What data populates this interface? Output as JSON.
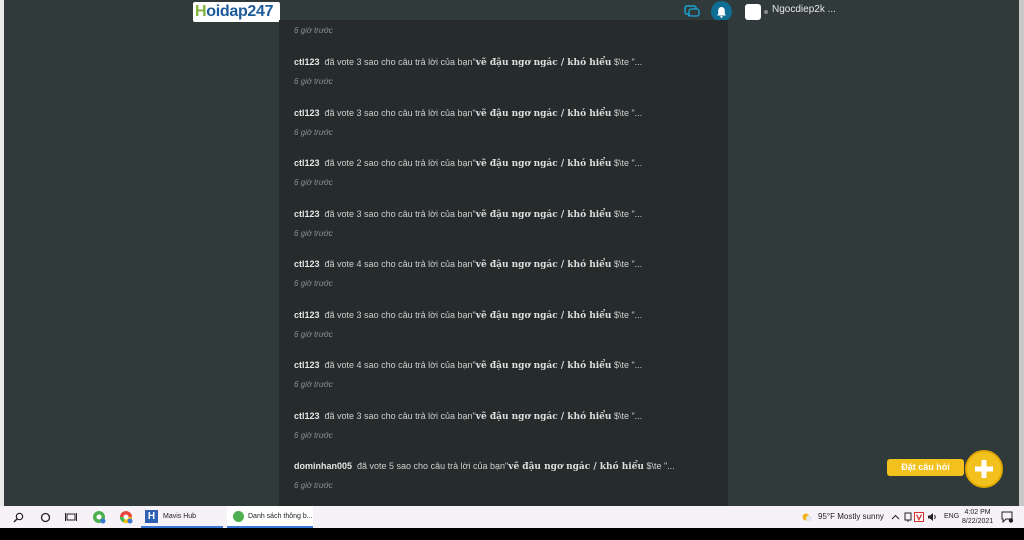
{
  "header": {
    "logo_h": "H",
    "logo_rest": "oidap247",
    "username": "Ngocdiep2k ..."
  },
  "feed": {
    "first_time": "6 giờ trước",
    "notifications": [
      {
        "user": "ctl123",
        "action": "đã vote 3 sao cho câu trả lời của bạn\"",
        "question": "vẽ đậu ngơ ngác / khó hiểu",
        "suffix": " $\\te \"...",
        "time": "6 giờ trước"
      },
      {
        "user": "ctl123",
        "action": "đã vote 3 sao cho câu trả lời của bạn\"",
        "question": "vẽ đậu ngơ ngác / khó hiểu",
        "suffix": " $\\te \"...",
        "time": "6 giờ trước"
      },
      {
        "user": "ctl123",
        "action": "đã vote 2 sao cho câu trả lời của bạn\"",
        "question": "vẽ đậu ngơ ngác / khó hiểu",
        "suffix": " $\\te \"...",
        "time": "6 giờ trước"
      },
      {
        "user": "ctl123",
        "action": "đã vote 3 sao cho câu trả lời của bạn\"",
        "question": "vẽ đậu ngơ ngác / khó hiểu",
        "suffix": " $\\te \"...",
        "time": "6 giờ trước"
      },
      {
        "user": "ctl123",
        "action": "đã vote 4 sao cho câu trả lời của bạn\"",
        "question": "vẽ đậu ngơ ngác / khó hiểu",
        "suffix": " $\\te \"...",
        "time": "6 giờ trước"
      },
      {
        "user": "ctl123",
        "action": "đã vote 3 sao cho câu trả lời của bạn\"",
        "question": "vẽ đậu ngơ ngác / khó hiểu",
        "suffix": " $\\te \"...",
        "time": "6 giờ trước"
      },
      {
        "user": "ctl123",
        "action": "đã vote 4 sao cho câu trả lời của bạn\"",
        "question": "vẽ đậu ngơ ngác / khó hiểu",
        "suffix": " $\\te \"...",
        "time": "6 giờ trước"
      },
      {
        "user": "ctl123",
        "action": "đã vote 3 sao cho câu trả lời của bạn\"",
        "question": "vẽ đậu ngơ ngác / khó hiểu",
        "suffix": " $\\te \"...",
        "time": "6 giờ trước"
      },
      {
        "user": "dominhan005",
        "action": "đã vote 5 sao cho câu trả lời của bạn\"",
        "question": "vẽ đậu ngơ ngác / khó hiểu",
        "suffix": " $\\te \"...",
        "time": "6 giờ trước"
      }
    ]
  },
  "ask_button": {
    "label": "Đặt câu hỏi"
  },
  "taskbar": {
    "apps": [
      {
        "label": "Mavis Hub"
      },
      {
        "label": "Danh sách thông b..."
      }
    ],
    "weather": "95°F  Mostly sunny",
    "language": "ENG",
    "time": "4:02 PM",
    "date": "8/22/2021"
  },
  "colors": {
    "accent": "#f3c11d",
    "page_bg": "#303a3b",
    "feed_bg": "#262b2c",
    "bell_bg": "#0f6c93"
  }
}
